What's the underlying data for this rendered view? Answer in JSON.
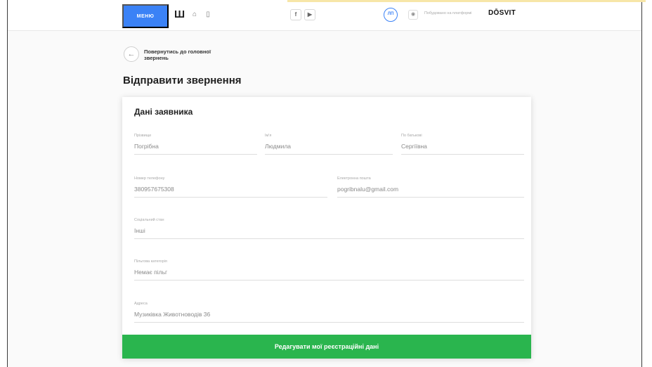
{
  "header": {
    "menu_label": "МЕНЮ",
    "trident_glyph": "Ш",
    "home_icon_glyph": "⌂",
    "mobile_icon_glyph": "▯",
    "facebook_glyph": "f",
    "youtube_glyph": "▶",
    "lang_label": "ЛП",
    "eye_glyph": "◉",
    "platform_text": "Побудовано на платформі",
    "platform_logo": "DŌSVIT"
  },
  "back": {
    "icon_glyph": "←",
    "label": "Повернутись до головної звернень"
  },
  "page_title": "Відправити звернення",
  "card": {
    "title": "Дані заявника",
    "fields": {
      "surname": {
        "label": "Прізвище",
        "value": "Погрібна"
      },
      "name": {
        "label": "Ім'я",
        "value": "Людмила"
      },
      "patronymic": {
        "label": "По батькові",
        "value": "Сергіївна"
      },
      "phone": {
        "label": "Номер телефону",
        "value": "380957675308"
      },
      "email": {
        "label": "Електронна пошта",
        "value": "pogribnalu@gmail.com"
      },
      "social_status": {
        "label": "Соціальний стан",
        "value": "Інші"
      },
      "benefit": {
        "label": "Пільгова категорія",
        "value": "Немає пільг"
      },
      "address": {
        "label": "Адреса",
        "value": "Музиківка Животноводів 36"
      }
    },
    "submit_label": "Редагувати мої реєстраційні дані"
  },
  "colors": {
    "menu_blue": "#3b82f6",
    "submit_green": "#2ab54e"
  }
}
